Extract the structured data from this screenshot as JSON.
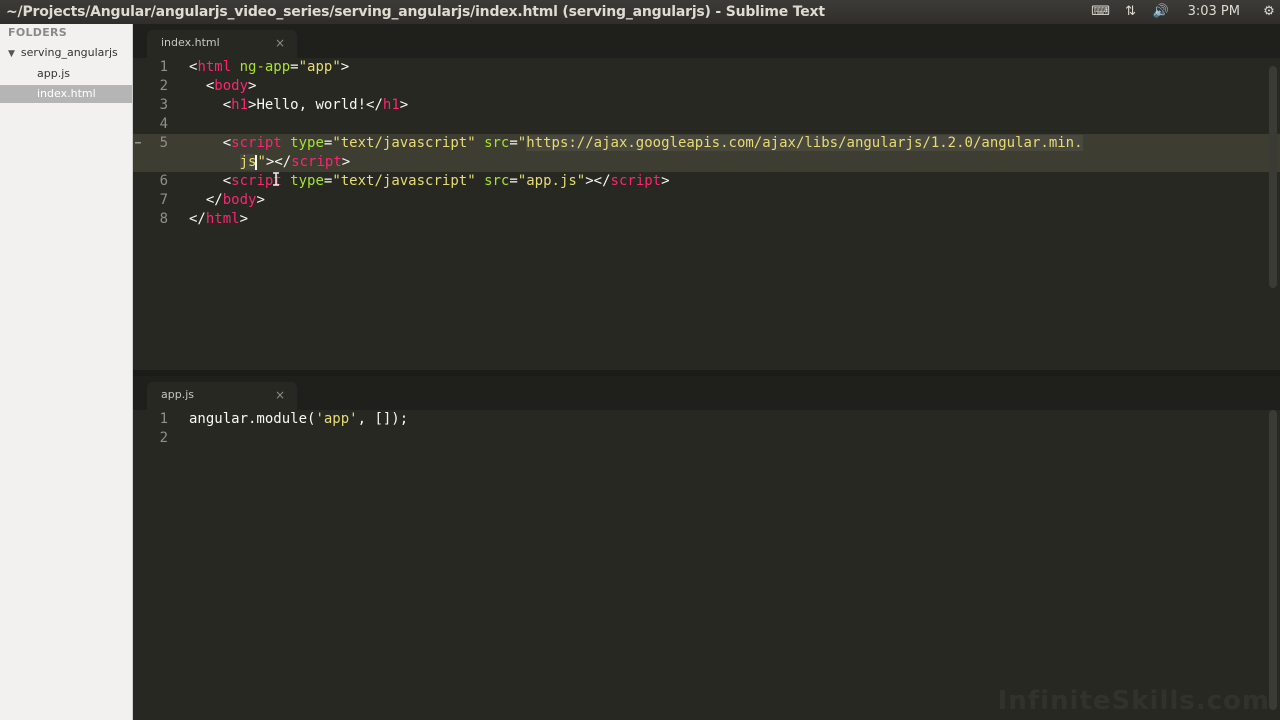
{
  "window": {
    "title": "~/Projects/Angular/angularjs_video_series/serving_angularjs/index.html (serving_angularjs) - Sublime Text",
    "time": "3:03 PM"
  },
  "sidebar": {
    "heading": "FOLDERS",
    "folder": "serving_angularjs",
    "files": [
      "app.js",
      "index.html"
    ],
    "active_file": "index.html"
  },
  "top_pane": {
    "tab": "index.html",
    "close": "×",
    "lines": {
      "n1": "1",
      "n2": "2",
      "n3": "3",
      "n4": "4",
      "n5": "5",
      "n6": "6",
      "n7": "7",
      "n8": "8",
      "l1_open": "<",
      "l1_tag": "html",
      "l1_attr": "ng-app",
      "l1_eq": "=",
      "l1_val": "\"app\"",
      "l1_close": ">",
      "l2_open": "<",
      "l2_tag": "body",
      "l2_close": ">",
      "l3_open": "<",
      "l3_tag": "h1",
      "l3_close": ">",
      "l3_text": "Hello, world!",
      "l3_end_open": "</",
      "l3_end_tag": "h1",
      "l3_end_close": ">",
      "l5_open": "<",
      "l5_tag": "script",
      "l5_attr1": "type",
      "l5_eq1": "=",
      "l5_val1": "\"text/javascript\"",
      "l5_attr2": "src",
      "l5_eq2": "=",
      "l5_q": "\"",
      "l5_url": "https://ajax.googleapis.com/ajax/libs/angularjs/1.2.0/angular.min.",
      "l5b_js": "js",
      "l5b_q": "\"",
      "l5b_close": ">",
      "l5b_end_open": "</",
      "l5b_end_tag": "script",
      "l5b_end_close": ">",
      "l6_open": "<",
      "l6_tag": "script",
      "l6_attr1": "type",
      "l6_eq1": "=",
      "l6_val1": "\"text/javascript\"",
      "l6_attr2": "src",
      "l6_eq2": "=",
      "l6_val2": "\"app.js\"",
      "l6_close": ">",
      "l6_end_open": "</",
      "l6_end_tag": "script",
      "l6_end_close": ">",
      "l7_open": "</",
      "l7_tag": "body",
      "l7_close": ">",
      "l8_open": "</",
      "l8_tag": "html",
      "l8_close": ">"
    }
  },
  "bottom_pane": {
    "tab": "app.js",
    "close": "×",
    "n1": "1",
    "n2": "2",
    "l1_a": "angular.module(",
    "l1_str": "'app'",
    "l1_b": ", []);"
  },
  "watermark": "InfiniteSkills.com",
  "colors": {
    "tag": "#f92672",
    "attribute": "#a6e22e",
    "string": "#e6db74",
    "text": "#f8f8f2",
    "background": "#272822"
  }
}
